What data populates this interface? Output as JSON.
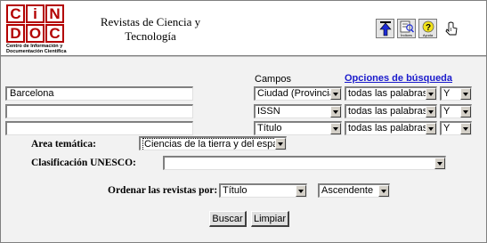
{
  "header": {
    "logo": {
      "letters": [
        "C",
        "i",
        "N",
        "D",
        "O",
        "C"
      ],
      "caption": "Centro de Información y Documentación Científica"
    },
    "title_line1": "Revistas de Ciencia y",
    "title_line2": "Tecnología",
    "toolbar": [
      {
        "icon": "arrow-up-icon",
        "label": ""
      },
      {
        "icon": "index-icon",
        "label": "Índices"
      },
      {
        "icon": "help-icon",
        "label": "Ayuda"
      },
      {
        "icon": "pointer-icon",
        "label": ""
      }
    ]
  },
  "search": {
    "campos_label": "Campos",
    "options_link": "Opciones de búsqueda",
    "rows": [
      {
        "value": "Barcelona",
        "field": "Ciudad (Provincia)",
        "mode": "todas las palabras",
        "op": "Y"
      },
      {
        "value": "",
        "field": "ISSN",
        "mode": "todas las palabras",
        "op": "Y"
      },
      {
        "value": "",
        "field": "Título",
        "mode": "todas las palabras",
        "op": "Y"
      }
    ]
  },
  "filters": {
    "area_label": "Area temática:",
    "area_value": "Ciencias de la tierra y del espacio",
    "unesco_label": "Clasificación UNESCO:",
    "unesco_value": ""
  },
  "sort": {
    "label": "Ordenar las revistas por:",
    "field": "Título",
    "order": "Ascendente"
  },
  "buttons": {
    "search": "Buscar",
    "clear": "Limpiar"
  },
  "colors": {
    "logo_red": "#b30000",
    "link_blue": "#1a1acc",
    "panel_bg": "#f2f2f2"
  }
}
